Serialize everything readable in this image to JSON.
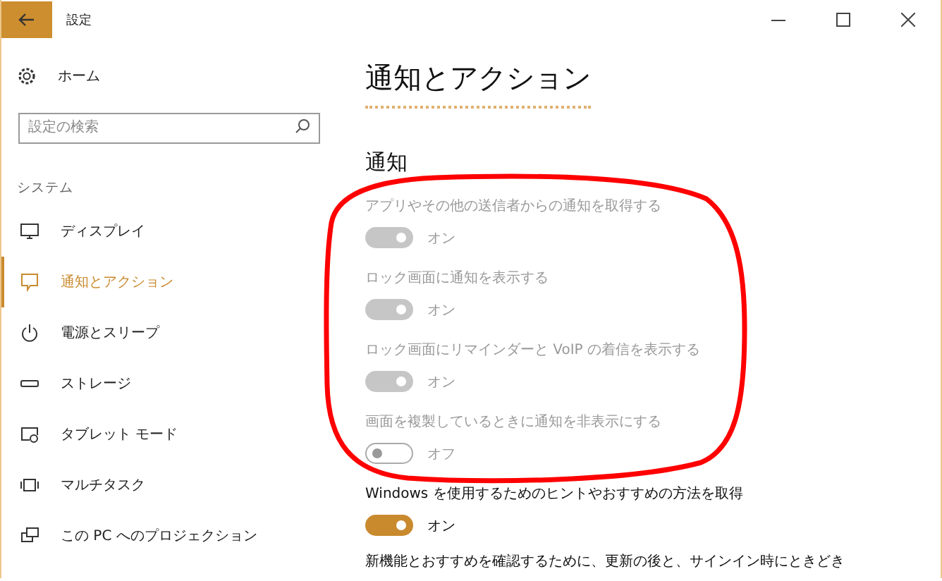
{
  "window": {
    "title": "設定"
  },
  "sidebar": {
    "home": "ホーム",
    "search": {
      "placeholder": "設定の検索"
    },
    "section": "システム",
    "items": [
      {
        "label": "ディスプレイ",
        "kind": "display",
        "selected": false
      },
      {
        "label": "通知とアクション",
        "kind": "notification",
        "selected": true
      },
      {
        "label": "電源とスリープ",
        "kind": "power",
        "selected": false
      },
      {
        "label": "ストレージ",
        "kind": "storage",
        "selected": false
      },
      {
        "label": "タブレット モード",
        "kind": "tablet",
        "selected": false
      },
      {
        "label": "マルチタスク",
        "kind": "multitask",
        "selected": false
      },
      {
        "label": "この PC へのプロジェクション",
        "kind": "projection",
        "selected": false
      }
    ]
  },
  "content": {
    "title": "通知とアクション",
    "section": "通知",
    "settings": [
      {
        "label": "アプリやその他の送信者からの通知を取得する",
        "on": true,
        "disabled": true,
        "state_text": "オン"
      },
      {
        "label": "ロック画面に通知を表示する",
        "on": true,
        "disabled": true,
        "state_text": "オン"
      },
      {
        "label": "ロック画面にリマインダーと VoIP の着信を表示する",
        "on": true,
        "disabled": true,
        "state_text": "オン"
      },
      {
        "label": "画面を複製しているときに通知を非表示にする",
        "on": false,
        "disabled": true,
        "state_text": "オフ"
      },
      {
        "label": "Windows を使用するためのヒントやおすすめの方法を取得",
        "on": true,
        "disabled": false,
        "state_text": "オン"
      }
    ],
    "footer_text": "新機能とおすすめを確認するために、更新の後と、サインイン時にときどき"
  }
}
